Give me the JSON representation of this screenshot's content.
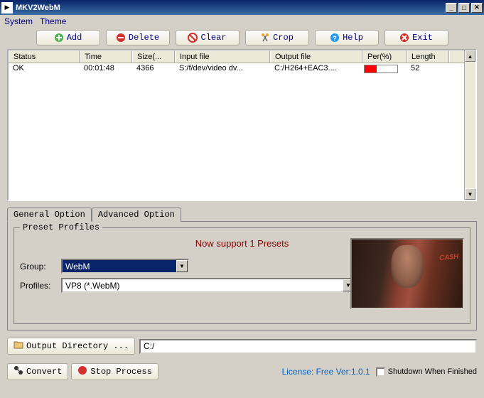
{
  "titlebar": {
    "title": "MKV2WebM"
  },
  "menu": {
    "system": "System",
    "theme": "Theme"
  },
  "toolbar": {
    "add": "Add",
    "delete": "Delete",
    "clear": "Clear",
    "crop": "Crop",
    "help": "Help",
    "exit": "Exit"
  },
  "table": {
    "headers": {
      "status": "Status",
      "time": "Time",
      "size": "Size(...",
      "input": "Input file",
      "output": "Output file",
      "per": "Per(%)",
      "length": "Length"
    },
    "rows": [
      {
        "status": "OK",
        "time": "00:01:48",
        "size": "4366",
        "input": "S:/f/dev/video dv...",
        "output": "C:/H264+EAC3....",
        "per_value": 37,
        "length": "52"
      }
    ]
  },
  "tabs": {
    "general": "General Option",
    "advanced": "Advanced Option"
  },
  "preset": {
    "legend": "Preset Profiles",
    "support_text": "Now support 1 Presets",
    "group_label": "Group:",
    "group_value": "WebM",
    "profiles_label": "Profiles:",
    "profiles_value": "VP8 (*.WebM)"
  },
  "output": {
    "button": "Output Directory ...",
    "path": "C:/"
  },
  "actions": {
    "convert": "Convert",
    "stop": "Stop Process"
  },
  "status": {
    "license": "License: Free Ver:1.0.1",
    "shutdown": "Shutdown When Finished"
  }
}
